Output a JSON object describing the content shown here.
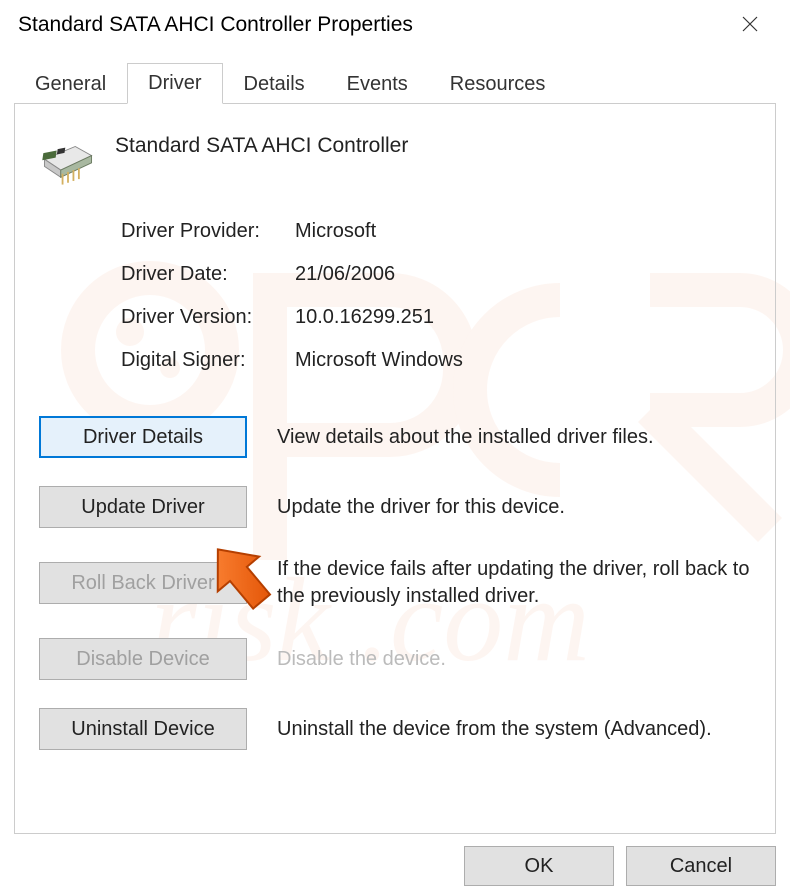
{
  "window": {
    "title": "Standard SATA AHCI Controller Properties"
  },
  "tabs": [
    {
      "label": "General"
    },
    {
      "label": "Driver"
    },
    {
      "label": "Details"
    },
    {
      "label": "Events"
    },
    {
      "label": "Resources"
    }
  ],
  "device": {
    "name": "Standard SATA AHCI Controller"
  },
  "driver_info": {
    "provider_label": "Driver Provider:",
    "provider_value": "Microsoft",
    "date_label": "Driver Date:",
    "date_value": "21/06/2006",
    "version_label": "Driver Version:",
    "version_value": "10.0.16299.251",
    "signer_label": "Digital Signer:",
    "signer_value": "Microsoft Windows"
  },
  "actions": {
    "details": {
      "label": "Driver Details",
      "desc": "View details about the installed driver files."
    },
    "update": {
      "label": "Update Driver",
      "desc": "Update the driver for this device."
    },
    "rollback": {
      "label": "Roll Back Driver",
      "desc": "If the device fails after updating the driver, roll back to the previously installed driver."
    },
    "disable": {
      "label": "Disable Device",
      "desc": "Disable the device."
    },
    "uninstall": {
      "label": "Uninstall Device",
      "desc": "Uninstall the device from the system (Advanced)."
    }
  },
  "footer": {
    "ok": "OK",
    "cancel": "Cancel"
  }
}
